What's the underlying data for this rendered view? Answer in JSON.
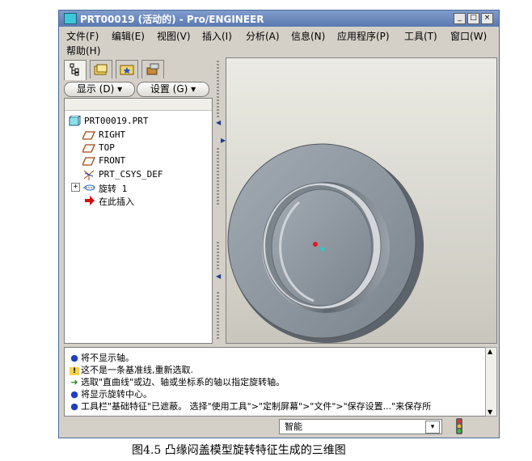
{
  "window": {
    "title": "PRT00019 (活动的) - Pro/ENGINEER",
    "controls": [
      "minimize",
      "maximize",
      "close"
    ]
  },
  "menubar": {
    "items": [
      "文件(F)",
      "编辑(E)",
      "视图(V)",
      "插入(I)",
      "分析(A)",
      "信息(N)",
      "应用程序(P)",
      "工具(T)",
      "窗口(W)",
      "帮助(H)"
    ]
  },
  "navigator": {
    "tabs": [
      "model-tree-icon",
      "folder-browser-icon",
      "favorites-icon",
      "connections-icon"
    ],
    "show_label": "显示 (D)",
    "settings_label": "设置 (G)"
  },
  "model_tree": {
    "items": [
      {
        "label": "PRT00019.PRT",
        "icon": "part-icon",
        "indent": 0
      },
      {
        "label": "RIGHT",
        "icon": "datum-plane-icon",
        "indent": 1
      },
      {
        "label": "TOP",
        "icon": "datum-plane-icon",
        "indent": 1
      },
      {
        "label": "FRONT",
        "icon": "datum-plane-icon",
        "indent": 1
      },
      {
        "label": "PRT_CSYS_DEF",
        "icon": "csys-icon",
        "indent": 1
      },
      {
        "label": "旋转 1",
        "icon": "revolve-icon",
        "indent": 1,
        "expandable": true
      },
      {
        "label": "在此插入",
        "icon": "insert-here-icon",
        "indent": 1
      }
    ]
  },
  "messages": [
    {
      "icon": "info-dot-icon",
      "color": "#1f3fbf",
      "text": "将不显示轴。"
    },
    {
      "icon": "warning-icon",
      "color": "#c8a000",
      "text": "这不是一条基准线,重新选取."
    },
    {
      "icon": "prompt-arrow-icon",
      "color": "#2a8c2a",
      "text": "选取\"直曲线\"或边、轴或坐标系的轴以指定旋转轴。"
    },
    {
      "icon": "info-dot-icon",
      "color": "#1f3fbf",
      "text": "将显示旋转中心。"
    },
    {
      "icon": "info-dot-icon",
      "color": "#1f3fbf",
      "text": "工具栏\"基础特征\"已遮蔽。  选择\"使用工具\">\"定制屏幕\">\"文件\">\"保存设置...\"来保存所"
    }
  ],
  "statusbar": {
    "filter_value": "智能"
  },
  "caption": "图4.5     凸缘闷盖模型旋转特征生成的三维图"
}
